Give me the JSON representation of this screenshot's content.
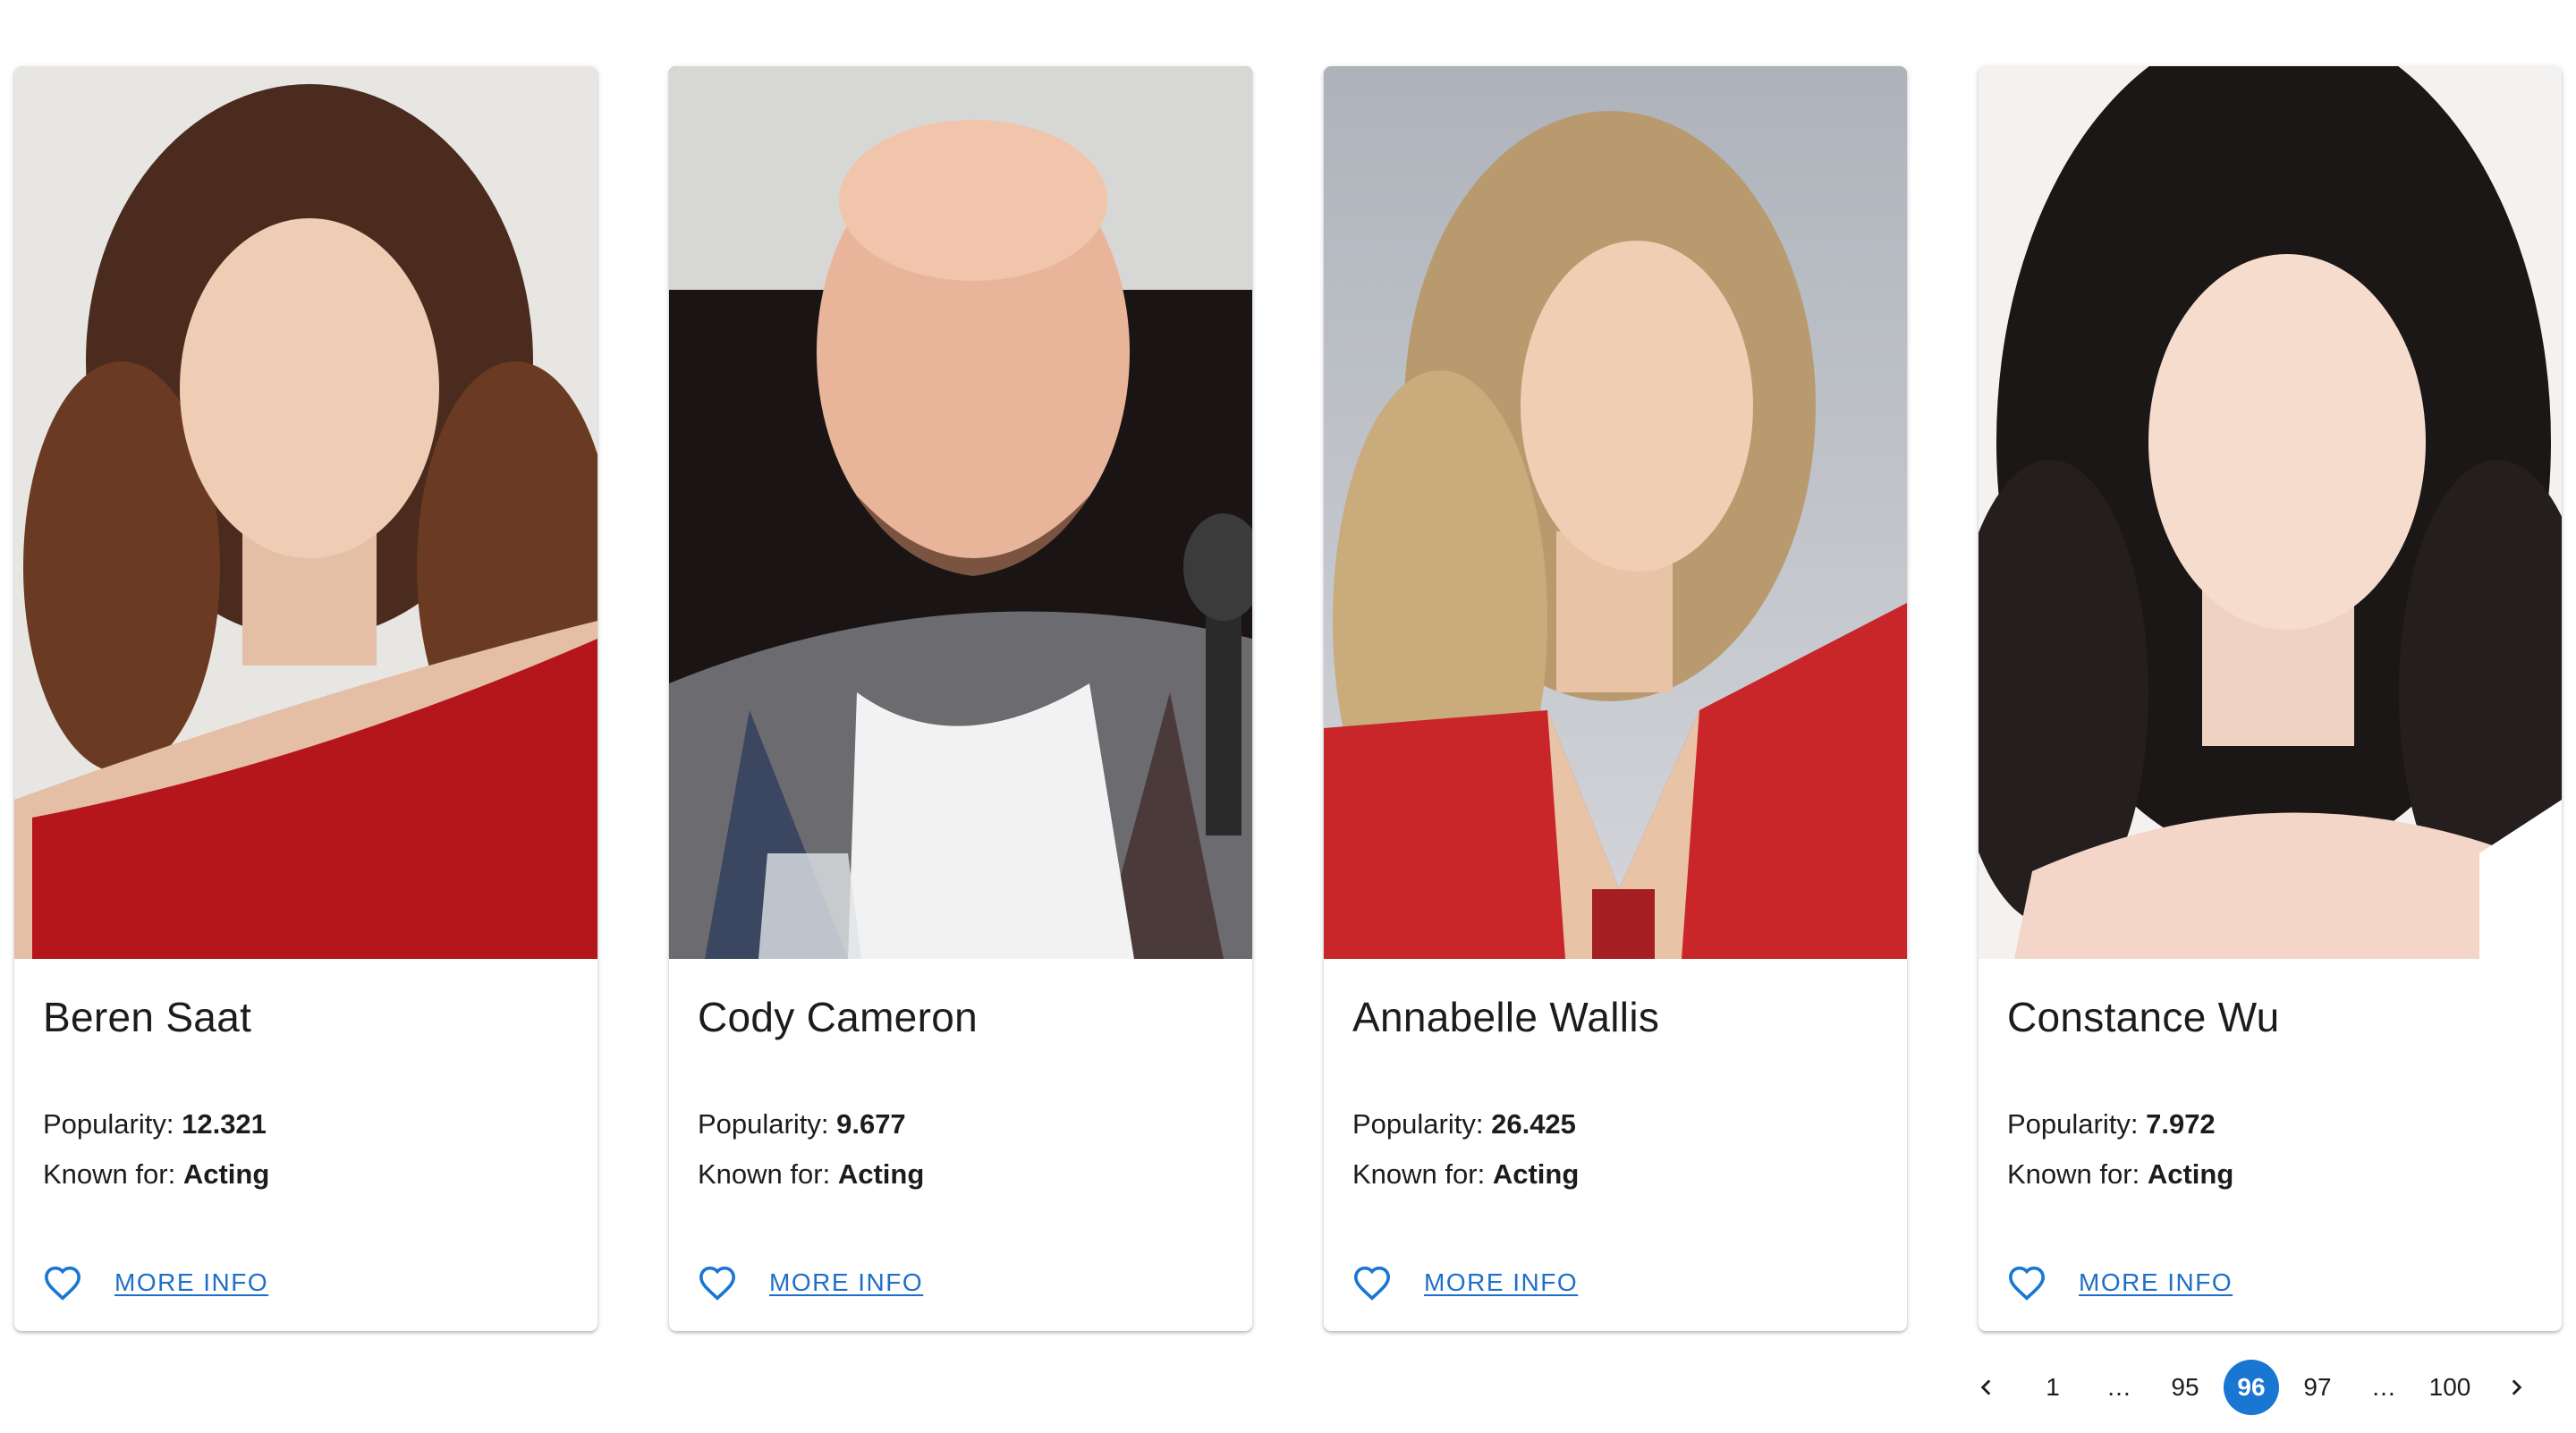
{
  "people": [
    {
      "name": "Beren Saat",
      "popularity_label": "Popularity:",
      "popularity": "12.321",
      "known_label": "Known for:",
      "known_for": "Acting",
      "more_info": "MORE INFO"
    },
    {
      "name": "Cody Cameron",
      "popularity_label": "Popularity:",
      "popularity": "9.677",
      "known_label": "Known for:",
      "known_for": "Acting",
      "more_info": "MORE INFO"
    },
    {
      "name": "Annabelle Wallis",
      "popularity_label": "Popularity:",
      "popularity": "26.425",
      "known_label": "Known for:",
      "known_for": "Acting",
      "more_info": "MORE INFO"
    },
    {
      "name": "Constance Wu",
      "popularity_label": "Popularity:",
      "popularity": "7.972",
      "known_label": "Known for:",
      "known_for": "Acting",
      "more_info": "MORE INFO"
    }
  ],
  "pagination": {
    "prev_icon": "chevron-left-icon",
    "next_icon": "chevron-right-icon",
    "pages": [
      "1",
      "…",
      "95",
      "96",
      "97",
      "…",
      "100"
    ],
    "current": "96"
  },
  "colors": {
    "accent": "#1976d2",
    "link": "#1f6fc9"
  }
}
